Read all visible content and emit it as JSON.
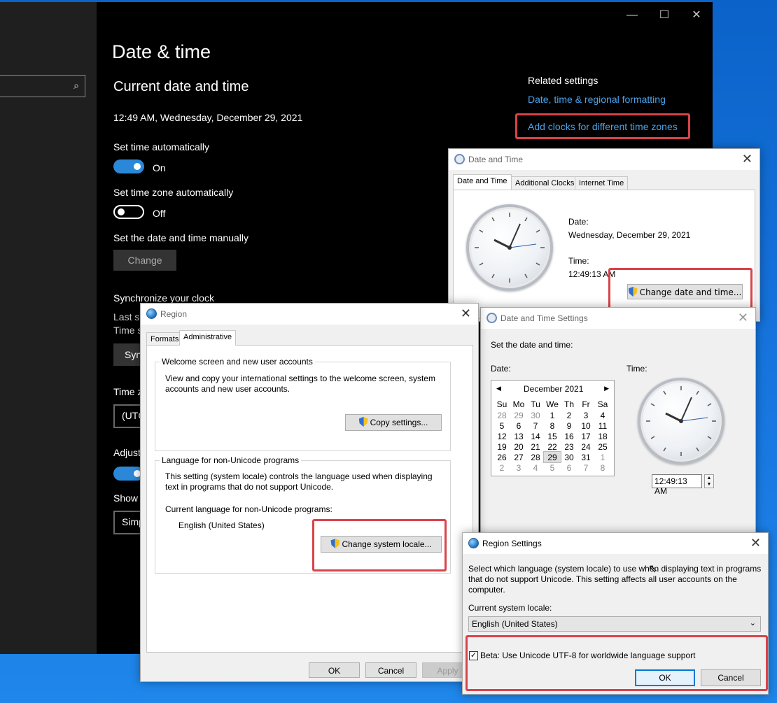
{
  "settings": {
    "title": "Date & time",
    "section_title": "Current date and time",
    "current_datetime": "12:49 AM, Wednesday, December 29, 2021",
    "set_time_auto_label": "Set time automatically",
    "set_time_auto_state": "On",
    "set_tz_auto_label": "Set time zone automatically",
    "set_tz_auto_state": "Off",
    "manual_label": "Set the date and time manually",
    "change_button": "Change",
    "sync_title": "Synchronize your clock",
    "sync_last_partial": "Last su",
    "sync_time_partial": "Time s",
    "sync_button_partial": "Syn",
    "timezone_label_partial": "Time z",
    "timezone_value_partial": "(UTC",
    "adjust_label_partial": "Adjust",
    "show_label_partial": "Show",
    "show_value_partial": "Simp",
    "related_title": "Related settings",
    "related_link_1": "Date, time & regional formatting",
    "related_link_2": "Add clocks for different time zones",
    "window_controls": {
      "minimize": "—",
      "maximize": "☐",
      "close": "✕"
    },
    "accent_color": "#4aa3ea",
    "highlight_color": "#d9434a"
  },
  "date_time_dialog": {
    "title": "Date and Time",
    "tabs": [
      "Date and Time",
      "Additional Clocks",
      "Internet Time"
    ],
    "date_label": "Date:",
    "date_value": "Wednesday, December 29, 2021",
    "time_label": "Time:",
    "time_value": "12:49:13 AM",
    "change_button": "Change date and time...",
    "close": "✕"
  },
  "dts_dialog": {
    "title": "Date and Time Settings",
    "instruction": "Set the date and time:",
    "date_label": "Date:",
    "time_label": "Time:",
    "month_label": "December 2021",
    "prev": "◀",
    "next": "▶",
    "weekdays": [
      "Su",
      "Mo",
      "Tu",
      "We",
      "Th",
      "Fr",
      "Sa"
    ],
    "weeks": [
      [
        "28",
        "29",
        "30",
        "1",
        "2",
        "3",
        "4"
      ],
      [
        "5",
        "6",
        "7",
        "8",
        "9",
        "10",
        "11"
      ],
      [
        "12",
        "13",
        "14",
        "15",
        "16",
        "17",
        "18"
      ],
      [
        "19",
        "20",
        "21",
        "22",
        "23",
        "24",
        "25"
      ],
      [
        "26",
        "27",
        "28",
        "29",
        "30",
        "31",
        "1"
      ],
      [
        "2",
        "3",
        "4",
        "5",
        "6",
        "7",
        "8"
      ]
    ],
    "selected_day": "29",
    "time_field": "12:49:13 AM",
    "close": "✕"
  },
  "region_dialog": {
    "title": "Region",
    "tabs": [
      "Formats",
      "Administrative"
    ],
    "welcome_group_title": "Welcome screen and new user accounts",
    "welcome_text": "View and copy your international settings to the welcome screen, system accounts and new user accounts.",
    "copy_button": "Copy settings...",
    "nonunicode_group_title": "Language for non-Unicode programs",
    "nonunicode_text": "This setting (system locale) controls the language used when displaying text in programs that do not support Unicode.",
    "current_lang_label": "Current language for non-Unicode programs:",
    "current_lang_value": "English (United States)",
    "change_locale_button": "Change system locale...",
    "ok": "OK",
    "cancel": "Cancel",
    "apply": "Apply",
    "close": "✕"
  },
  "region_settings_dialog": {
    "title": "Region Settings",
    "description": "Select which language (system locale) to use when displaying text in programs that do not support Unicode. This setting affects all user accounts on the computer.",
    "locale_label": "Current system locale:",
    "locale_value": "English (United States)",
    "beta_checkbox_label": "Beta: Use Unicode UTF-8 for worldwide language support",
    "beta_checked": true,
    "ok": "OK",
    "cancel": "Cancel",
    "close": "✕"
  }
}
